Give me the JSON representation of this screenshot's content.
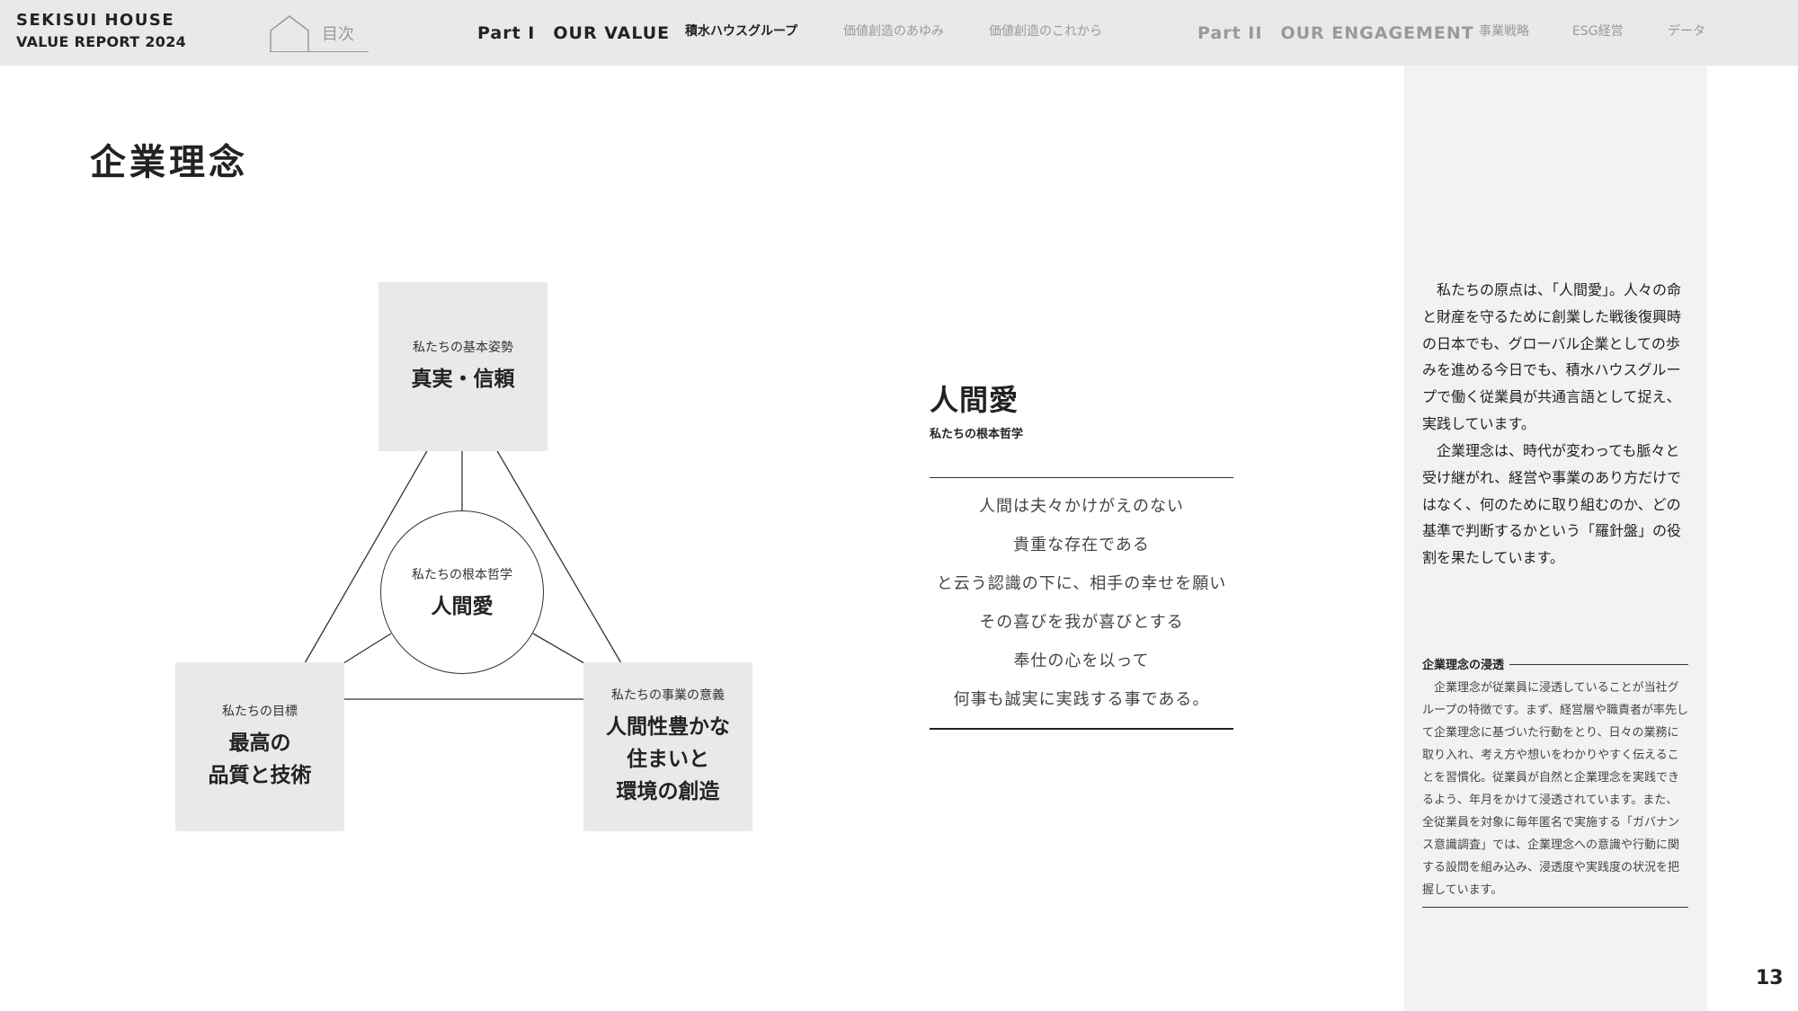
{
  "header": {
    "brand_line1": "SEKISUI HOUSE",
    "brand_line2": "VALUE REPORT 2024",
    "toc_label": "目次",
    "part1": "Part I　OUR VALUE",
    "part1_items": [
      "積水ハウスグループ",
      "価値創造のあゆみ",
      "価値創造のこれから"
    ],
    "part2": "Part II　OUR ENGAGEMENT",
    "part2_items": [
      "事業戦略",
      "ESG経営",
      "データ"
    ]
  },
  "page_title": "企業理念",
  "diagram": {
    "top": {
      "sub": "私たちの基本姿勢",
      "main": "真実・信頼"
    },
    "center": {
      "sub": "私たちの根本哲学",
      "main": "人間愛"
    },
    "left": {
      "sub": "私たちの目標",
      "main_line1": "最高の",
      "main_line2": "品質と技術"
    },
    "right": {
      "sub": "私たちの事業の意義",
      "main_line1": "人間性豊かな",
      "main_line2": "住まいと",
      "main_line3": "環境の創造"
    }
  },
  "philosophy": {
    "title": "人間愛",
    "subtitle": "私たちの根本哲学",
    "lines": [
      "人間は夫々かけがえのない",
      "貴重な存在である",
      "と云う認識の下に、相手の幸せを願い",
      "その喜びを我が喜びとする",
      "奉仕の心を以って",
      "何事も誠実に実践する事である。"
    ]
  },
  "side": {
    "para1": "私たちの原点は、「人間愛」。人々の命と財産を守るために創業した戦後復興時の日本でも、グローバル企業としての歩みを進める今日でも、積水ハウスグループで働く従業員が共通言語として捉え、実践しています。",
    "para2": "企業理念は、時代が変わっても脈々と受け継がれ、経営や事業のあり方だけではなく、何のために取り組むのか、どの基準で判断するかという「羅針盤」の役割を果たしています。",
    "heading": "企業理念の浸透",
    "small": "企業理念が従業員に浸透していることが当社グループの特徴です。まず、経営層や職責者が率先して企業理念に基づいた行動をとり、日々の業務に取り入れ、考え方や想いをわかりやすく伝えることを習慣化。従業員が自然と企業理念を実践できるよう、年月をかけて浸透されています。また、全従業員を対象に毎年匿名で実施する「ガバナンス意識調査」では、企業理念への意識や行動に関する設問を組み込み、浸透度や実践度の状況を把握しています。"
  },
  "page_number": "13"
}
